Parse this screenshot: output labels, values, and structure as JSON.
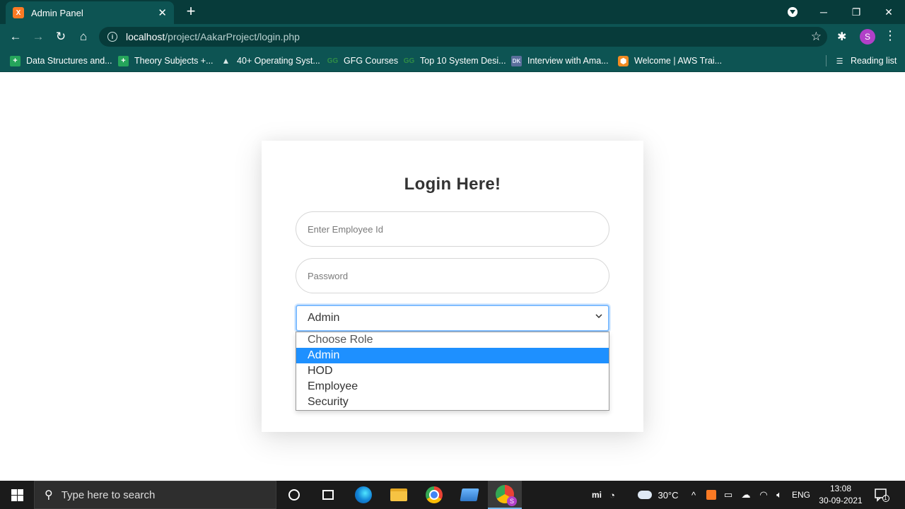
{
  "browser": {
    "tab_title": "Admin Panel",
    "tab_favicon_letter": "X",
    "url_host": "localhost",
    "url_path": "/project/AakarProject/login.php",
    "profile_initial": "S",
    "bookmarks": [
      {
        "label": "Data Structures and...",
        "icon": "google-sheets-icon"
      },
      {
        "label": "Theory Subjects +...",
        "icon": "google-sheets-icon"
      },
      {
        "label": "40+ Operating Syst...",
        "icon": "mountain-icon"
      },
      {
        "label": "GFG Courses",
        "icon": "gfg-icon"
      },
      {
        "label": "Top 10 System Desi...",
        "icon": "gfg-icon"
      },
      {
        "label": "Interview with Ama...",
        "icon": "dk-icon",
        "icon_text": "DK"
      },
      {
        "label": "Welcome | AWS Trai...",
        "icon": "aws-icon"
      }
    ],
    "reading_list": "Reading list"
  },
  "login": {
    "title": "Login Here!",
    "employee_id_placeholder": "Enter Employee Id",
    "password_placeholder": "Password",
    "role_selected": "Admin",
    "role_options": [
      "Choose Role",
      "Admin",
      "HOD",
      "Employee",
      "Security"
    ]
  },
  "taskbar": {
    "search_placeholder": "Type here to search",
    "weather": "30°C",
    "language": "ENG",
    "time": "13:08",
    "date": "30-09-2021",
    "notification_count": "1"
  },
  "colors": {
    "chrome_dark": "#073b3a",
    "chrome": "#0d5453",
    "select_highlight": "#1e90ff",
    "focus_border": "#80bdff"
  }
}
